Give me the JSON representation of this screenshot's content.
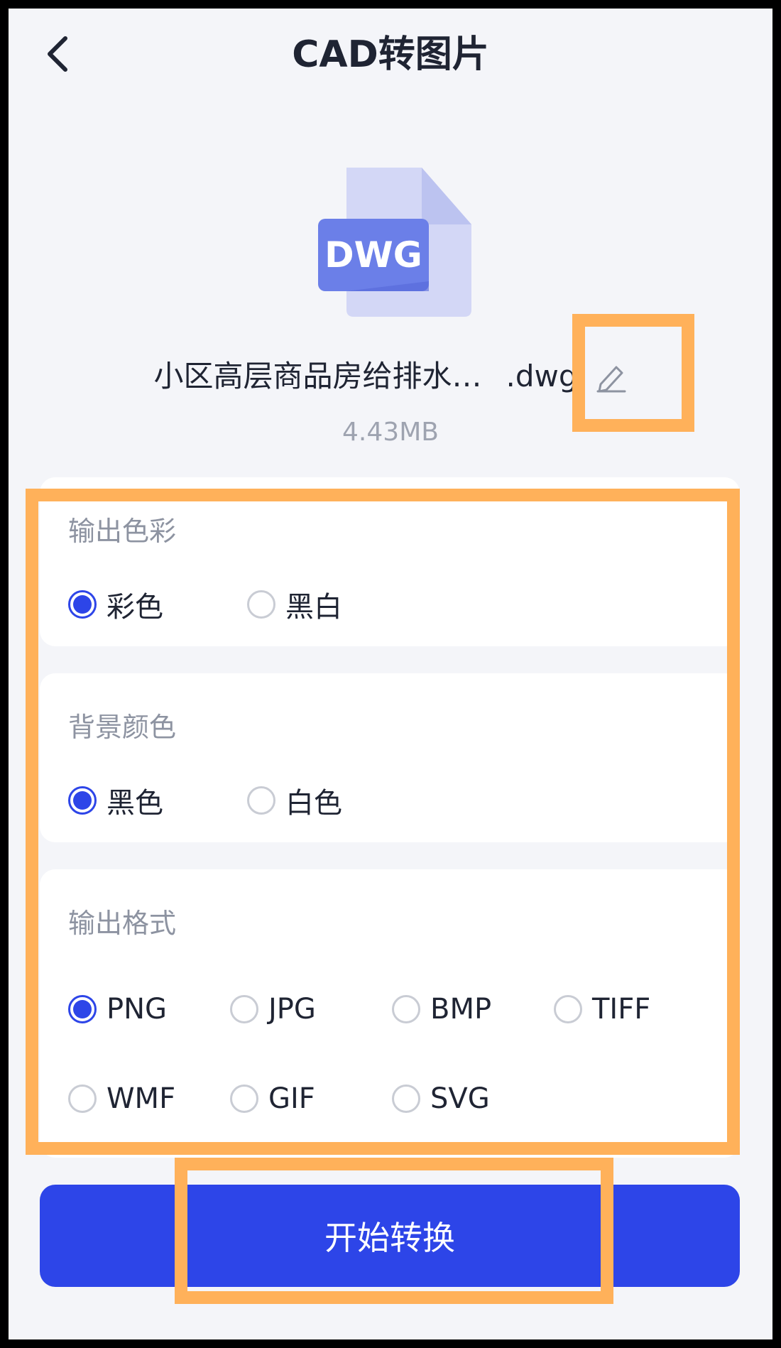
{
  "header": {
    "title": "CAD转图片"
  },
  "file": {
    "icon_label": "DWG",
    "name": "小区高层商品房给排水…",
    "ext": ".dwg",
    "size": "4.43MB"
  },
  "sections": {
    "color": {
      "label": "输出色彩",
      "options": [
        "彩色",
        "黑白"
      ],
      "selected": "彩色"
    },
    "background": {
      "label": "背景颜色",
      "options": [
        "黑色",
        "白色"
      ],
      "selected": "黑色"
    },
    "format": {
      "label": "输出格式",
      "options": [
        "PNG",
        "JPG",
        "BMP",
        "TIFF",
        "WMF",
        "GIF",
        "SVG"
      ],
      "selected": "PNG"
    }
  },
  "actions": {
    "start_label": "开始转换"
  },
  "colors": {
    "accent": "#2d45e8",
    "background": "#f4f5f9",
    "highlight": "#ffb15a",
    "file_icon_light": "#d3d7f6",
    "file_icon_badge": "#6b7fe8"
  }
}
